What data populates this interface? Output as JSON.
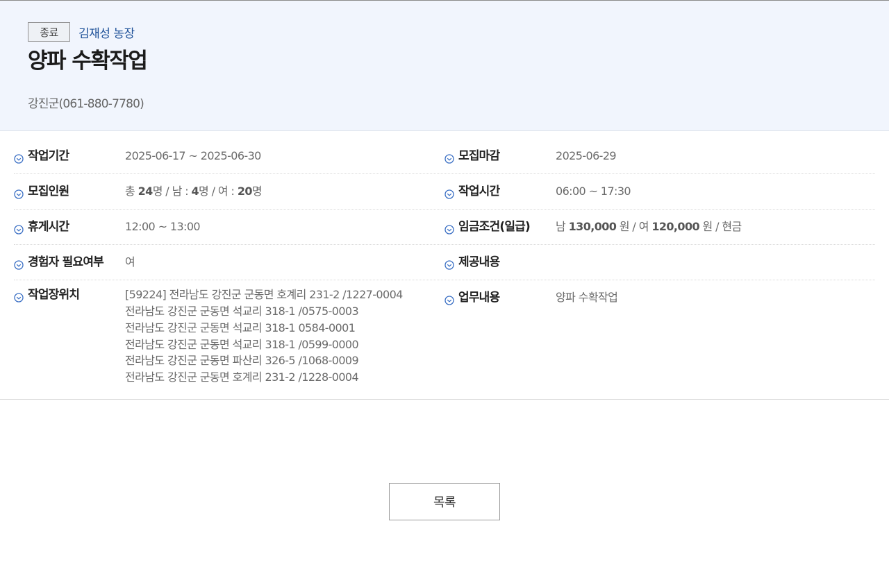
{
  "header": {
    "status_badge": "종료",
    "farm_name": "김재성 농장",
    "title": "양파 수확작업",
    "contact": "강진군(061-880-7780)"
  },
  "info": {
    "work_period": {
      "label": "작업기간",
      "value": "2025-06-17 ~ 2025-06-30"
    },
    "recruit_deadline": {
      "label": "모집마감",
      "value": "2025-06-29"
    },
    "recruit_count": {
      "label": "모집인원",
      "total_prefix": "총",
      "total": "24",
      "male_prefix": "명 / 남 :",
      "male": "4",
      "female_prefix": "명 / 여 :",
      "female": "20",
      "suffix": "명"
    },
    "work_time": {
      "label": "작업시간",
      "value": "06:00 ~ 17:30"
    },
    "break_time": {
      "label": "휴게시간",
      "value": "12:00 ~ 13:00"
    },
    "wage": {
      "label": "임금조건(일급)",
      "male_prefix": "남",
      "male_amount": "130,000",
      "female_prefix": "원 / 여",
      "female_amount": "120,000",
      "suffix": "원 / 현금"
    },
    "experience": {
      "label": "경험자 필요여부",
      "value": "여"
    },
    "provision": {
      "label": "제공내용",
      "value": ""
    },
    "location": {
      "label": "작업장위치",
      "lines": [
        "[59224] 전라남도 강진군 군동면 호계리 231-2 /1227-0004",
        "전라남도 강진군 군동면 석교리 318-1 /0575-0003",
        "전라남도 강진군 군동면 석교리 318-1 0584-0001",
        "전라남도 강진군 군동면 석교리 318-1 /0599-0000",
        "전라남도 강진군 군동면 파산리 326-5 /1068-0009",
        "전라남도 강진군 군동면 호계리 231-2 /1228-0004"
      ]
    },
    "task": {
      "label": "업무내용",
      "value": "양파 수확작업"
    }
  },
  "actions": {
    "list_button": "목록"
  },
  "icons": {
    "row_marker": "check-circle-icon"
  },
  "colors": {
    "accent": "#1a4e97",
    "header_bg": "#f1f5fd",
    "icon": "#3a6fc4"
  }
}
